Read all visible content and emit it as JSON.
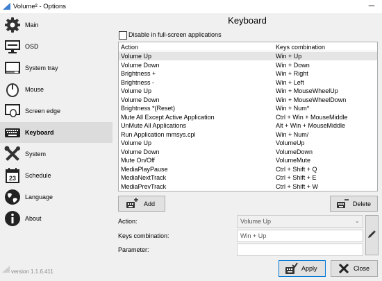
{
  "window": {
    "title": "Volume² - Options",
    "minimize": "─"
  },
  "sidebar": {
    "items": [
      {
        "label": "Main",
        "icon": "gear-icon"
      },
      {
        "label": "OSD",
        "icon": "monitor-icon"
      },
      {
        "label": "System tray",
        "icon": "system-tray-icon"
      },
      {
        "label": "Mouse",
        "icon": "mouse-icon"
      },
      {
        "label": "Screen edge",
        "icon": "screen-edge-icon"
      },
      {
        "label": "Keyboard",
        "icon": "keyboard-icon",
        "active": true
      },
      {
        "label": "System",
        "icon": "tools-icon"
      },
      {
        "label": "Schedule",
        "icon": "calendar-icon",
        "day": "23"
      },
      {
        "label": "Language",
        "icon": "globe-icon"
      },
      {
        "label": "About",
        "icon": "info-icon"
      }
    ],
    "version": "version 1.1.6.411"
  },
  "panel": {
    "title": "Keyboard",
    "disable_fullscreen": {
      "label": "Disable in full-screen applications",
      "checked": false
    },
    "table": {
      "headers": {
        "action": "Action",
        "keys": "Keys combination"
      },
      "rows": [
        {
          "action": "Volume Up",
          "keys": "Win + Up"
        },
        {
          "action": "Volume Down",
          "keys": "Win + Down"
        },
        {
          "action": "Brightness +",
          "keys": "Win + Right"
        },
        {
          "action": "Brightness -",
          "keys": "Win + Left"
        },
        {
          "action": "Volume Up",
          "keys": "Win + MouseWheelUp"
        },
        {
          "action": "Volume Down",
          "keys": "Win + MouseWheelDown"
        },
        {
          "action": "Brightness *(Reset)",
          "keys": "Win + Num*"
        },
        {
          "action": "Mute All Except Active Application",
          "keys": "Ctrl + Win + MouseMiddle"
        },
        {
          "action": "UnMute All Applications",
          "keys": "Alt + Win + MouseMiddle"
        },
        {
          "action": "Run Application mmsys.cpl",
          "keys": "Win + Num/"
        },
        {
          "action": "Volume Up",
          "keys": "VolumeUp"
        },
        {
          "action": "Volume Down",
          "keys": "VolumeDown"
        },
        {
          "action": "Mute On/Off",
          "keys": "VolumeMute"
        },
        {
          "action": "MediaPlayPause",
          "keys": "Ctrl + Shift + Q"
        },
        {
          "action": "MediaNextTrack",
          "keys": "Ctrl + Shift + E"
        },
        {
          "action": "MediaPrevTrack",
          "keys": "Ctrl + Shift + W"
        }
      ],
      "selected_index": 0
    },
    "buttons": {
      "add": "Add",
      "delete": "Delete",
      "apply": "Apply",
      "close": "Close"
    },
    "form": {
      "action_label": "Action:",
      "action_value": "Volume Up",
      "keys_label": "Keys combination:",
      "keys_value": "Win + Up",
      "parameter_label": "Parameter:",
      "parameter_value": ""
    }
  }
}
